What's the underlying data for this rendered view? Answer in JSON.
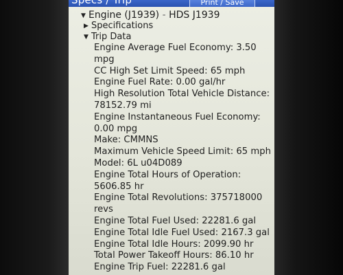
{
  "header": {
    "title": "Specs / Trip",
    "print_save_label": "Print / Save"
  },
  "tree": {
    "engine_name": "Engine (J1939)",
    "engine_separator": "-",
    "engine_suffix": "HDS J1939",
    "specifications_label": "Specifications",
    "trip_data_label": "Trip Data",
    "caret_expanded": "▼",
    "caret_collapsed": "▶"
  },
  "trip_lines": [
    "Engine Average Fuel Economy: 3.50",
    "mpg",
    "CC High Set Limit Speed: 65 mph",
    "Engine Fuel Rate: 0.00 gal/hr",
    "High Resolution Total Vehicle Distance:",
    "78152.79 mi",
    "Engine Instantaneous Fuel Economy:",
    "0.00 mpg",
    "Make: CMMNS",
    "Maximum Vehicle Speed Limit: 65 mph",
    "Model: 6L u04D089",
    "Engine Total Hours of Operation:",
    "5606.85 hr",
    "Engine Total Revolutions: 375718000",
    "revs",
    "Engine Total Fuel Used: 22281.6 gal",
    "Engine Total Idle Fuel Used: 2167.3 gal",
    "Engine Total Idle Hours: 2099.90 hr",
    "Total Power Takeoff Hours: 86.10 hr",
    "Engine Trip Fuel: 22281.6 gal"
  ]
}
